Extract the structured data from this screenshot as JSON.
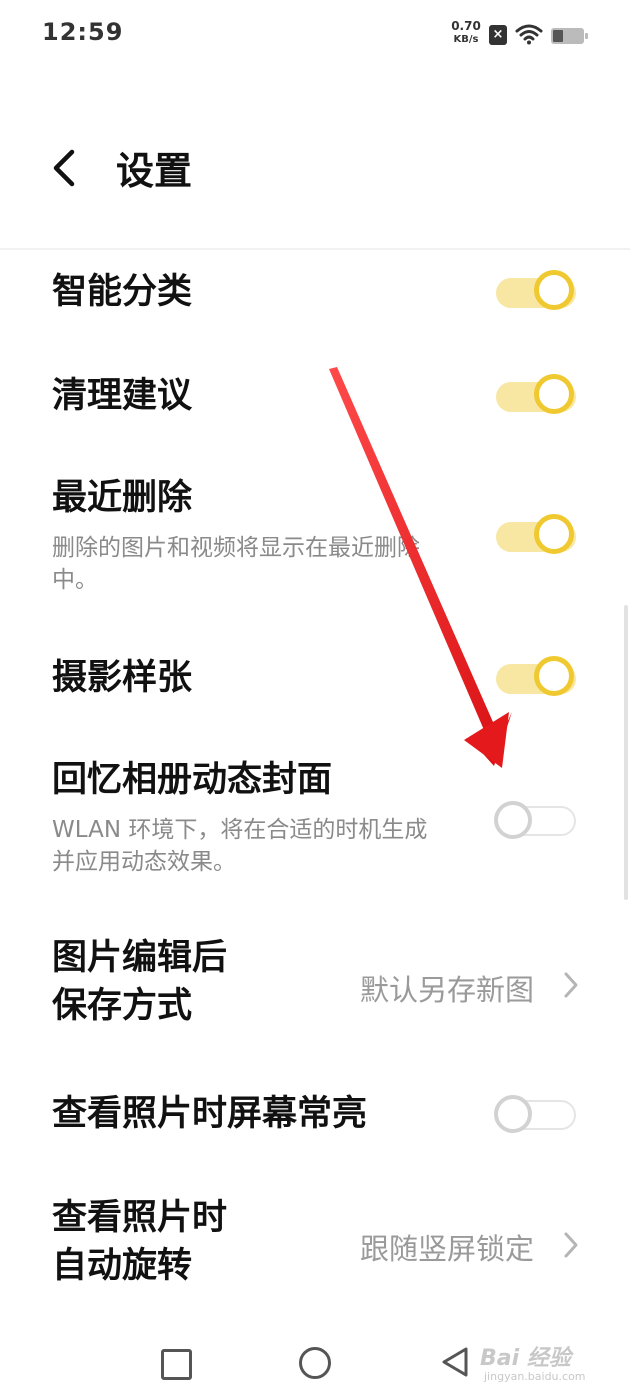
{
  "status_bar": {
    "time": "12:59",
    "net_speed": "0.70",
    "net_unit": "KB/s",
    "sim_icon": "sim-no-service-icon",
    "wifi_icon": "wifi-icon",
    "battery_icon": "battery-icon"
  },
  "header": {
    "title": "设置",
    "back_icon": "chevron-left-icon"
  },
  "settings": [
    {
      "title": "智能分类",
      "type": "toggle",
      "on": true
    },
    {
      "title": "清理建议",
      "type": "toggle",
      "on": true
    },
    {
      "title": "最近删除",
      "subtitle": "删除的图片和视频将显示在最近删除中。",
      "type": "toggle",
      "on": true
    },
    {
      "title": "摄影样张",
      "type": "toggle",
      "on": true
    },
    {
      "title": "回忆相册动态封面",
      "subtitle": "WLAN 环境下，将在合适的时机生成并应用动态效果。",
      "type": "toggle",
      "on": false
    },
    {
      "title_line1": "图片编辑后",
      "title_line2": "保存方式",
      "type": "select",
      "value": "默认另存新图"
    },
    {
      "title": "查看照片时屏幕常亮",
      "type": "toggle",
      "on": false
    },
    {
      "title_line1": "查看照片时",
      "title_line2": "自动旋转",
      "type": "select",
      "value": "跟随竖屏锁定"
    }
  ],
  "nav_bar": {
    "recents_icon": "square-icon",
    "home_icon": "circle-icon",
    "back_icon": "triangle-back-icon"
  },
  "watermark": {
    "main": "Bai 经验",
    "sub": "jingyan.baidu.com"
  },
  "colors": {
    "toggle_on_track": "#f7e7a3",
    "toggle_on_knob": "#f0c930",
    "annotation_arrow": "#e3191b"
  }
}
